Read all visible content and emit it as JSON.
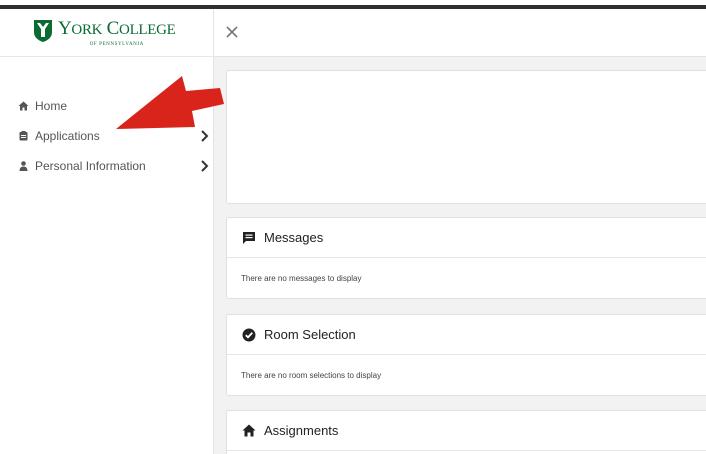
{
  "brand": {
    "name_main": "YORK COLLEGE",
    "name_y": "Y",
    "name_ork": "ORK",
    "name_c": "C",
    "name_ollege": "OLLEGE",
    "name_sub": "OF PENNSYLVANIA",
    "color": "#0b6b33"
  },
  "sidebar": {
    "items": [
      {
        "label": "Home",
        "icon": "home-icon",
        "has_chevron": false
      },
      {
        "label": "Applications",
        "icon": "clipboard-icon",
        "has_chevron": true
      },
      {
        "label": "Personal Information",
        "icon": "user-icon",
        "has_chevron": true
      }
    ]
  },
  "header": {
    "close_icon": "close-icon"
  },
  "cards": [
    {
      "title": "Messages",
      "icon": "message-icon",
      "body": "There are no messages to display"
    },
    {
      "title": "Room Selection",
      "icon": "check-circle-icon",
      "body": "There are no room selections to display"
    },
    {
      "title": "Assignments",
      "icon": "home-icon",
      "body": ""
    }
  ],
  "annotation": {
    "arrow_color": "#d9241c"
  }
}
